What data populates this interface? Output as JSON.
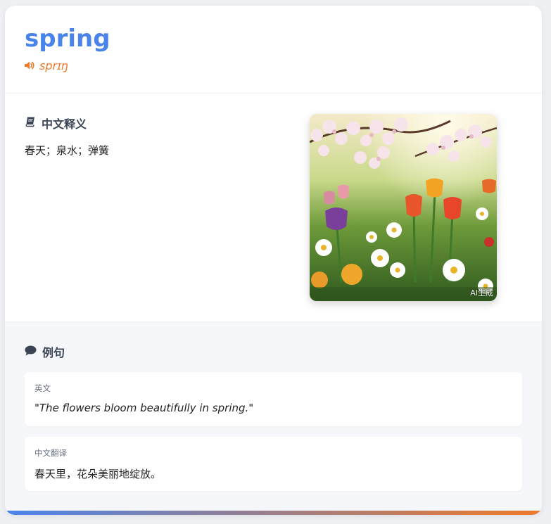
{
  "entry": {
    "word": "spring",
    "phonetic": "sprɪŋ"
  },
  "definition": {
    "heading": "中文释义",
    "text": "春天；泉水；弹簧"
  },
  "image": {
    "badge": "AI生成"
  },
  "examples": {
    "heading": "例句",
    "english_label": "英文",
    "english_text": "\"The flowers bloom beautifully in spring.\"",
    "chinese_label": "中文翻译",
    "chinese_text": "春天里，花朵美丽地绽放。"
  },
  "colors": {
    "word": "#4a84ea",
    "phonetic": "#ee7a2a",
    "heading": "#3a4455"
  },
  "icons": {
    "phonetic": "speaker-icon",
    "definition": "book-icon",
    "examples": "speech-bubble-icon"
  }
}
